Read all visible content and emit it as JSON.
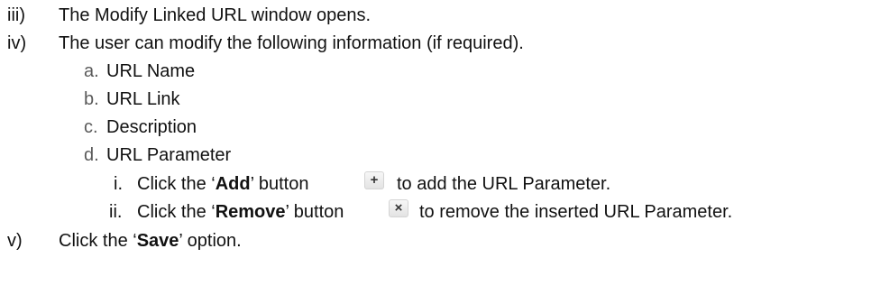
{
  "steps": [
    {
      "marker": "iii)",
      "text": "The Modify Linked URL window opens."
    },
    {
      "marker": "iv)",
      "text": "The user can modify the following information (if required)."
    }
  ],
  "sub_items": [
    {
      "marker": "a.",
      "text": "URL Name"
    },
    {
      "marker": "b.",
      "text": "URL Link"
    },
    {
      "marker": "c.",
      "text": "Description"
    },
    {
      "marker": "d.",
      "text": "URL Parameter"
    }
  ],
  "param_items": [
    {
      "marker": "i.",
      "pre": "Click the ‘",
      "bold": "Add",
      "mid": "’ button",
      "icon": "plus-icon",
      "post": "to add the URL Parameter."
    },
    {
      "marker": "ii.",
      "pre": "Click the ‘",
      "bold": "Remove",
      "mid": "’ button",
      "icon": "close-icon",
      "post": "to remove the inserted URL Parameter."
    }
  ],
  "final_step": {
    "marker": "v)",
    "pre": "Click the ‘",
    "bold": "Save",
    "post": "’ option."
  },
  "icons": {
    "plus": "+",
    "close": "×"
  }
}
